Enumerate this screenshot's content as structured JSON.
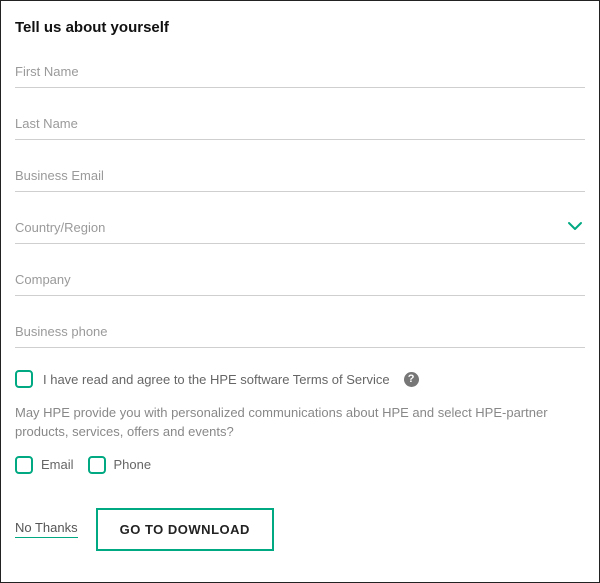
{
  "heading": "Tell us about yourself",
  "fields": {
    "first_name": {
      "placeholder": "First Name",
      "value": ""
    },
    "last_name": {
      "placeholder": "Last Name",
      "value": ""
    },
    "business_email": {
      "placeholder": "Business Email",
      "value": ""
    },
    "country_region": {
      "placeholder": "Country/Region",
      "value": ""
    },
    "company": {
      "placeholder": "Company",
      "value": ""
    },
    "business_phone": {
      "placeholder": "Business phone",
      "value": ""
    }
  },
  "terms": {
    "label": "I have read and agree to the HPE software Terms of Service",
    "checked": false
  },
  "consent": {
    "question": "May HPE provide you with personalized communications about HPE and select HPE-partner products, services, offers and events?",
    "options": {
      "email": {
        "label": "Email",
        "checked": false
      },
      "phone": {
        "label": "Phone",
        "checked": false
      }
    }
  },
  "footer": {
    "no_thanks": "No Thanks",
    "cta": "GO TO DOWNLOAD"
  },
  "colors": {
    "accent": "#01a982"
  }
}
